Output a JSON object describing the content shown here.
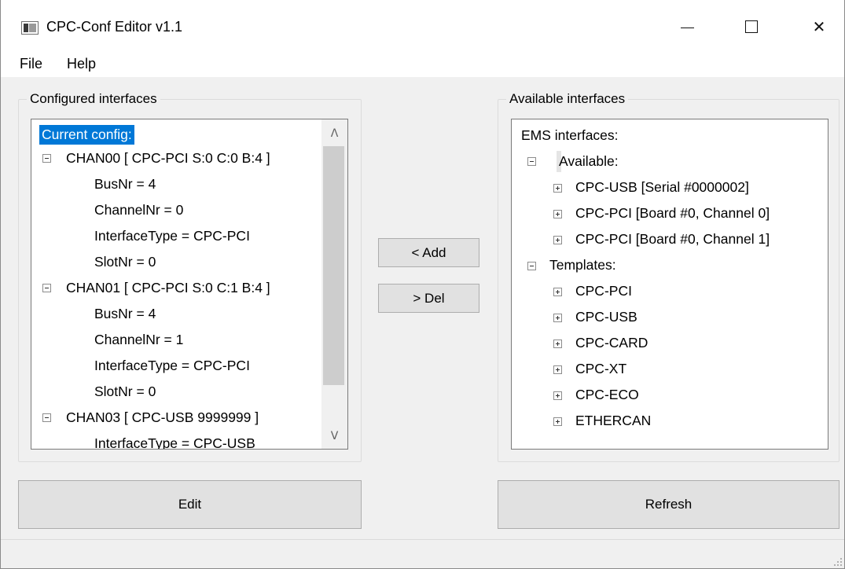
{
  "window": {
    "title": "CPC-Conf Editor v1.1",
    "app_icon": "app-window-icon",
    "controls": {
      "minimize": "minimize-icon",
      "maximize": "maximize-icon",
      "close": "close-icon",
      "close_glyph": "✕"
    }
  },
  "menu": {
    "file": "File",
    "help": "Help"
  },
  "configured": {
    "group_title": "Configured interfaces",
    "root": "Current config:",
    "items": [
      {
        "label": "CHAN00 [ CPC-PCI S:0 C:0 B:4 ]",
        "expanded": true
      },
      {
        "label": "BusNr = 4"
      },
      {
        "label": "ChannelNr = 0"
      },
      {
        "label": "InterfaceType = CPC-PCI"
      },
      {
        "label": "SlotNr = 0"
      },
      {
        "label": "CHAN01 [ CPC-PCI S:0 C:1 B:4 ]",
        "expanded": true
      },
      {
        "label": "BusNr = 4"
      },
      {
        "label": "ChannelNr = 1"
      },
      {
        "label": "InterfaceType = CPC-PCI"
      },
      {
        "label": "SlotNr = 0"
      },
      {
        "label": "CHAN03 [ CPC-USB 9999999 ]",
        "expanded": true
      },
      {
        "label": "InterfaceType = CPC-USB"
      }
    ],
    "scroll_up_glyph": "ᐱ",
    "scroll_down_glyph": "ᐯ"
  },
  "actions": {
    "add": "< Add",
    "del": "> Del"
  },
  "available": {
    "group_title": "Available interfaces",
    "root": "EMS interfaces:",
    "available_label": "Available:",
    "available_items": [
      "CPC-USB [Serial #0000002]",
      "CPC-PCI [Board #0, Channel 0]",
      "CPC-PCI [Board #0, Channel 1]"
    ],
    "templates_label": "Templates:",
    "template_items": [
      "CPC-PCI",
      "CPC-USB",
      "CPC-CARD",
      "CPC-XT",
      "CPC-ECO",
      "ETHERCAN"
    ]
  },
  "buttons": {
    "edit": "Edit",
    "refresh": "Refresh"
  },
  "colors": {
    "selection": "#0078d7",
    "window_bg": "#f0f0f0"
  }
}
